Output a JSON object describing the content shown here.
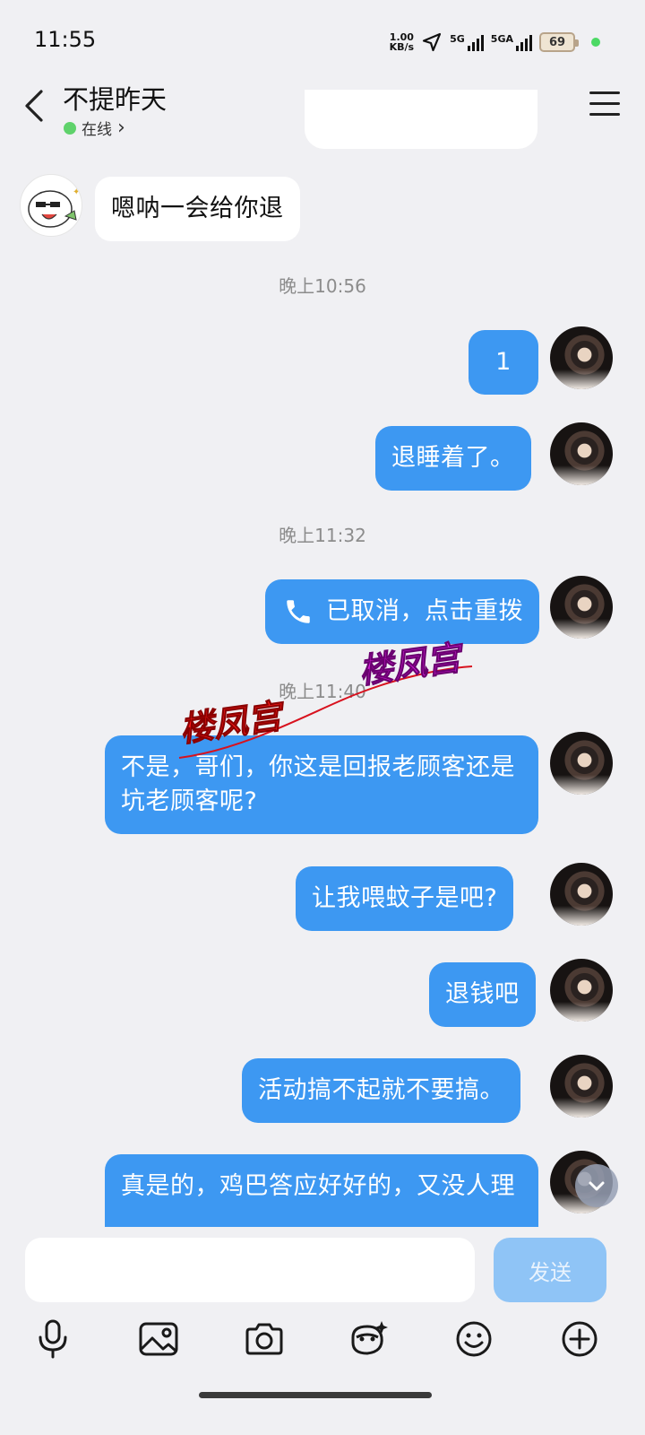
{
  "status_bar": {
    "time": "11:55",
    "net_speed_value": "1.00",
    "net_speed_unit": "KB/s",
    "sim1_label": "5G",
    "sim2_label": "5GA",
    "battery": "69"
  },
  "header": {
    "contact_name": "不提昨天",
    "status": "在线",
    "status_chevron": "›"
  },
  "messages": {
    "m1": {
      "text": "嗯呐一会给你退",
      "side": "incoming"
    },
    "t1": "晚上10:56",
    "m2": {
      "text": "1",
      "side": "outgoing"
    },
    "m3": {
      "text": "退睡着了。",
      "side": "outgoing"
    },
    "t2": "晚上11:32",
    "m4": {
      "text": "已取消，点击重拨",
      "side": "outgoing",
      "icon": "phone-icon"
    },
    "t3": "晚上11:40",
    "m5": {
      "text": "不是，哥们，你这是回报老顾客还是坑老顾客呢?",
      "side": "outgoing"
    },
    "m6": {
      "text": "让我喂蚊子是吧?",
      "side": "outgoing"
    },
    "m7": {
      "text": "退钱吧",
      "side": "outgoing"
    },
    "m8": {
      "text": "活动搞不起就不要搞。",
      "side": "outgoing"
    },
    "m9": {
      "text": "真是的，鸡巴答应好好的，又没人理",
      "side": "outgoing"
    }
  },
  "watermark": {
    "text1": "楼凤宫",
    "text2": "楼凤宫",
    "color1": "#ff1a1a",
    "color2": "#d21cd8"
  },
  "composer": {
    "input_value": "",
    "send_label": "发送"
  },
  "toolbar_icons": [
    "microphone-icon",
    "image-icon",
    "camera-icon",
    "sticker-icon",
    "emoji-icon",
    "plus-icon"
  ],
  "colors": {
    "outgoing_bubble": "#3d98f2",
    "incoming_bubble": "#ffffff",
    "background": "#f0f0f3",
    "send_button": "#8fc4f6"
  }
}
